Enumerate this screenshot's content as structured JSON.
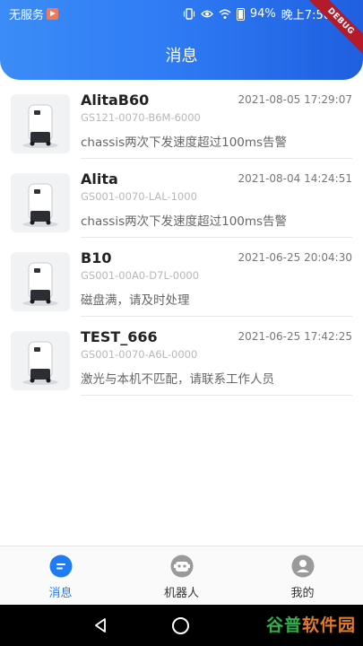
{
  "status_bar": {
    "carrier": "无服务",
    "battery": "94%",
    "time": "晚上7:56",
    "debug_label": "DEBUG",
    "icons": [
      "vibrate-icon",
      "eye-icon",
      "wifi-icon",
      "battery-icon"
    ]
  },
  "header": {
    "title": "消息"
  },
  "messages": [
    {
      "name": "AlitaB60",
      "time": "2021-08-05 17:29:07",
      "serial": "GS121-0070-B6M-6000",
      "text": "chassis两次下发速度超过100ms告警"
    },
    {
      "name": "Alita",
      "time": "2021-08-04 14:24:51",
      "serial": "GS001-0070-LAL-1000",
      "text": "chassis两次下发速度超过100ms告警"
    },
    {
      "name": "B10",
      "time": "2021-06-25 20:04:30",
      "serial": "GS001-00A0-D7L-0000",
      "text": "磁盘满，请及时处理"
    },
    {
      "name": "TEST_666",
      "time": "2021-06-25 17:42:25",
      "serial": "GS001-0070-A6L-0000",
      "text": "激光与本机不匹配，请联系工作人员"
    }
  ],
  "tabs": [
    {
      "label": "消息",
      "icon": "message-icon",
      "active": true
    },
    {
      "label": "机器人",
      "icon": "robot-icon",
      "active": false
    },
    {
      "label": "我的",
      "icon": "profile-icon",
      "active": false
    }
  ],
  "nav": {
    "watermark_a": "谷普",
    "watermark_b": "软件园"
  },
  "colors": {
    "accent": "#1f7cf3",
    "header_start": "#3b8cf6",
    "header_end": "#1f5fe0"
  }
}
